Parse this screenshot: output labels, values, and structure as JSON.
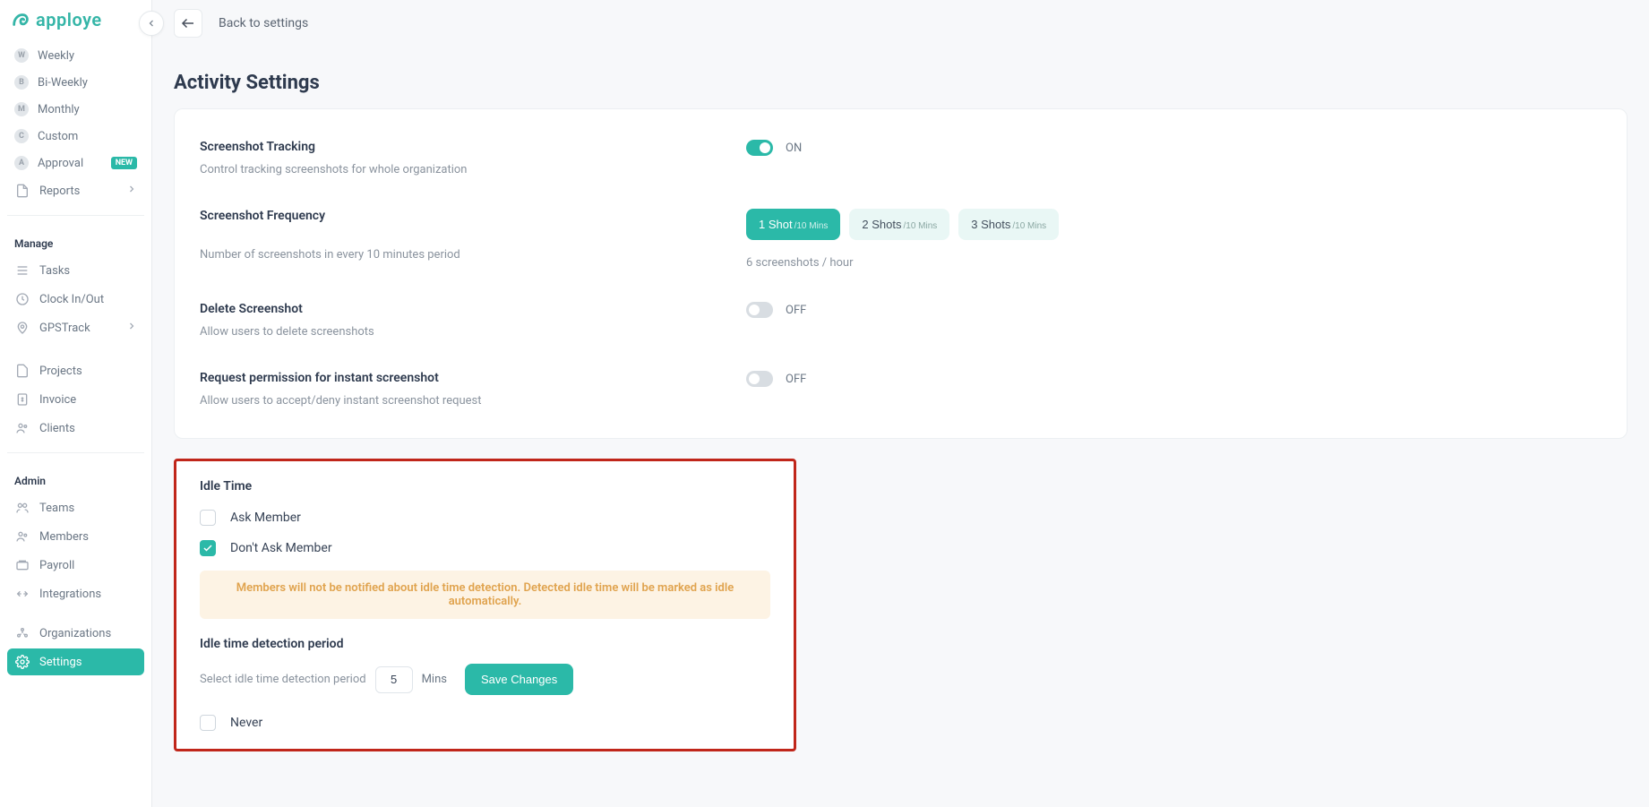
{
  "brand": {
    "name": "apploye"
  },
  "topbar": {
    "back_label": "Back to settings"
  },
  "sidebar": {
    "items_top": [
      {
        "label": "Weekly",
        "icon_letter": "W"
      },
      {
        "label": "Bi-Weekly",
        "icon_letter": "B"
      },
      {
        "label": "Monthly",
        "icon_letter": "M"
      },
      {
        "label": "Custom",
        "icon_letter": "C"
      },
      {
        "label": "Approval",
        "icon_letter": "A",
        "badge": "NEW"
      }
    ],
    "reports_label": "Reports",
    "manage_label": "Manage",
    "manage_items": [
      {
        "label": "Tasks"
      },
      {
        "label": "Clock In/Out"
      },
      {
        "label": "GPSTrack",
        "has_chevron": true
      },
      {
        "label": "Projects"
      },
      {
        "label": "Invoice"
      },
      {
        "label": "Clients"
      }
    ],
    "admin_label": "Admin",
    "admin_items": [
      {
        "label": "Teams"
      },
      {
        "label": "Members"
      },
      {
        "label": "Payroll"
      },
      {
        "label": "Integrations"
      },
      {
        "label": "Organizations"
      },
      {
        "label": "Settings",
        "active": true
      }
    ]
  },
  "page": {
    "title": "Activity Settings"
  },
  "tracking": {
    "title": "Screenshot Tracking",
    "desc": "Control tracking screenshots for whole organization",
    "state_label": "ON"
  },
  "frequency": {
    "title": "Screenshot Frequency",
    "desc": "Number of screenshots in every 10 minutes period",
    "options": [
      {
        "main": "1 Shot",
        "sub": "/10 Mins"
      },
      {
        "main": "2 Shots",
        "sub": "/10 Mins"
      },
      {
        "main": "3 Shots",
        "sub": "/10 Mins"
      }
    ],
    "note": "6 screenshots / hour"
  },
  "delete_ss": {
    "title": "Delete Screenshot",
    "desc": "Allow users to delete screenshots",
    "state_label": "OFF"
  },
  "instant": {
    "title": "Request permission for instant screenshot",
    "desc": "Allow users to accept/deny instant screenshot request",
    "state_label": "OFF"
  },
  "idle": {
    "title": "Idle Time",
    "ask_label": "Ask Member",
    "dont_ask_label": "Don't Ask Member",
    "notice": "Members will not be notified about idle time detection. Detected idle time will be marked as idle automatically.",
    "detect_title": "Idle time detection period",
    "detect_label": "Select idle time detection period",
    "minutes_value": "5",
    "mins_label": "Mins",
    "save_label": "Save Changes",
    "never_label": "Never"
  }
}
